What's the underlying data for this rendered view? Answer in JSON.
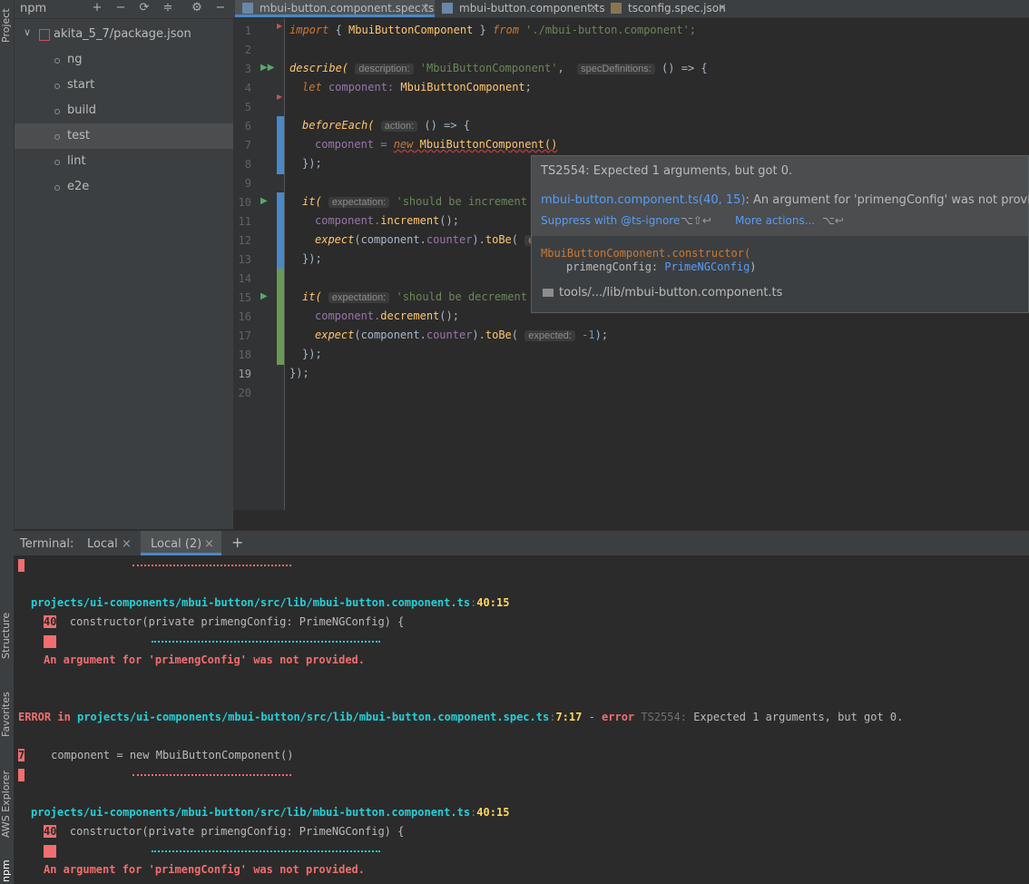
{
  "left_strip": {
    "project": "Project",
    "structure": "Structure",
    "favorites": "Favorites",
    "aws": "AWS Explorer",
    "npm": "npm"
  },
  "npm_panel": {
    "title": "npm",
    "root": "akita_5_7/package.json",
    "scripts": [
      "ng",
      "start",
      "build",
      "test",
      "lint",
      "e2e"
    ],
    "selected": "test"
  },
  "tabs": [
    {
      "label": "mbui-button.component.spec.ts",
      "active": true
    },
    {
      "label": "mbui-button.component.ts",
      "active": false
    },
    {
      "label": "tsconfig.spec.json",
      "active": false
    }
  ],
  "editor": {
    "line_numbers": [
      "1",
      "2",
      "3",
      "4",
      "5",
      "6",
      "7",
      "8",
      "9",
      "10",
      "11",
      "12",
      "13",
      "14",
      "15",
      "16",
      "17",
      "18",
      "19",
      "20"
    ],
    "current_line": "19",
    "code": {
      "l1_import": "import",
      "l1_brace_open": " { ",
      "l1_class": "MbuiButtonComponent",
      "l1_brace_close": " } ",
      "l1_from": "from",
      "l1_path": " './mbui-button.component';",
      "l3_describe": "describe(",
      "l3_hint1": "description:",
      "l3_str": "'MbuiButtonComponent'",
      "l3_comma": ",",
      "l3_hint2": "specDefinitions:",
      "l3_rest": " () => {",
      "l4_let": "let",
      "l4_var": " component: ",
      "l4_type": "MbuiButtonComponent",
      "l4_semi": ";",
      "l6_fn": "beforeEach(",
      "l6_hint": "action:",
      "l6_rest": " () => {",
      "l7_var": "component = ",
      "l7_new": "new",
      "l7_class": " MbuiButtonComponent()",
      "l8": "});",
      "l10_fn": "it(",
      "l10_hint": "expectation:",
      "l10_str": "'should be increment c",
      "l11_obj": "component.",
      "l11_call": "increment",
      "l11_rest": "();",
      "l12_expect": "expect",
      "l12_paren": "(component.",
      "l12_prop": "counter",
      "l12_dot": ").",
      "l12_call": "toBe",
      "l12_rest": "(",
      "l12_hint": "ex",
      "l13": "});",
      "l15_fn": "it(",
      "l15_hint": "expectation:",
      "l15_str": "'should be decrement c",
      "l16_obj": "component.",
      "l16_call": "decrement",
      "l16_rest": "();",
      "l17_expect": "expect",
      "l17_paren": "(component.",
      "l17_prop": "counter",
      "l17_dot": ").",
      "l17_call": "toBe",
      "l17_open": "(",
      "l17_hint": "expected:",
      "l17_val": " -1",
      "l17_close": ");",
      "l18": "});",
      "l19": "});"
    }
  },
  "popup": {
    "error_title": "TS2554: Expected 1 arguments, but got 0.",
    "link": "mbui-button.component.ts(40, 15)",
    "link_rest": ": An argument for 'primengConfig' was not provided.",
    "suppress": "Suppress with @ts-ignore",
    "suppress_shortcut": "⌥⇧↩",
    "more_actions": "More actions...",
    "more_shortcut": "⌥↩",
    "sig_class": "MbuiButtonComponent.constructor(",
    "sig_param": "primengConfig: ",
    "sig_type": "PrimeNGConfig",
    "sig_close": ")",
    "file_path": "tools/.../lib/mbui-button.component.ts"
  },
  "terminal": {
    "label": "Terminal:",
    "tabs": [
      "Local",
      "Local (2)"
    ],
    "active_tab": "Local (2)",
    "add": "+",
    "path1": "projects/ui-components/mbui-button/src/lib/mbui-button.component.ts",
    "loc1": "40:15",
    "linenum40": "40",
    "ctor_line": "  constructor(private primengConfig: PrimeNGConfig) {",
    "arg_msg": "An argument for 'primengConfig' was not provided.",
    "error_prefix": "ERROR in ",
    "error_path": "projects/ui-components/mbui-button/src/lib/mbui-button.component.spec.ts",
    "error_loc": "7:17",
    "error_dash": " - ",
    "error_word": "error",
    "error_code": " TS2554: ",
    "error_msg": "Expected 1 arguments, but got 0.",
    "linenum7": "7",
    "comp_line": "    component = new MbuiButtonComponent()",
    "path2": "projects/ui-components/mbui-button/src/lib/mbui-button.component.ts",
    "loc2": "40:15"
  },
  "colors": {
    "accent": "#4a88c7",
    "error": "#f26e6e",
    "cyan": "#23d0d8",
    "yellow": "#ffd85e",
    "link": "#589df6"
  }
}
